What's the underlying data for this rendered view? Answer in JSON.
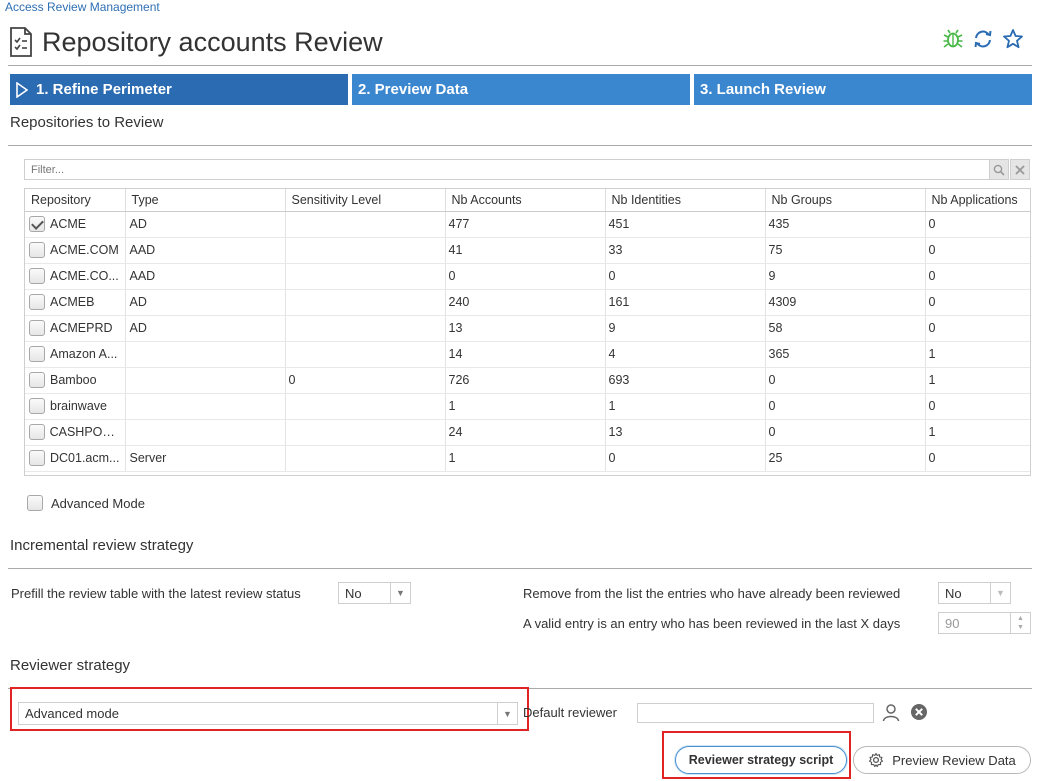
{
  "breadcrumb": "Access Review Management",
  "page_title": "Repository accounts Review",
  "steps": [
    {
      "label": "1. Refine Perimeter"
    },
    {
      "label": "2. Preview Data"
    },
    {
      "label": "3. Launch Review"
    }
  ],
  "repositories": {
    "title": "Repositories to Review",
    "filter_placeholder": "Filter...",
    "columns": [
      "Repository",
      "Type",
      "Sensitivity Level",
      "Nb Accounts",
      "Nb Identities",
      "Nb Groups",
      "Nb Applications"
    ],
    "rows": [
      {
        "checked": true,
        "repository": "ACME",
        "type": "AD",
        "sensitivity": "",
        "accounts": "477",
        "identities": "451",
        "groups": "435",
        "applications": "0"
      },
      {
        "checked": false,
        "repository": "ACME.COM",
        "type": "AAD",
        "sensitivity": "",
        "accounts": "41",
        "identities": "33",
        "groups": "75",
        "applications": "0"
      },
      {
        "checked": false,
        "repository": "ACME.CO...",
        "type": "AAD",
        "sensitivity": "",
        "accounts": "0",
        "identities": "0",
        "groups": "9",
        "applications": "0"
      },
      {
        "checked": false,
        "repository": "ACMEB",
        "type": "AD",
        "sensitivity": "",
        "accounts": "240",
        "identities": "161",
        "groups": "4309",
        "applications": "0"
      },
      {
        "checked": false,
        "repository": "ACMEPRD",
        "type": "AD",
        "sensitivity": "",
        "accounts": "13",
        "identities": "9",
        "groups": "58",
        "applications": "0"
      },
      {
        "checked": false,
        "repository": "Amazon A...",
        "type": "",
        "sensitivity": "",
        "accounts": "14",
        "identities": "4",
        "groups": "365",
        "applications": "1"
      },
      {
        "checked": false,
        "repository": "Bamboo",
        "type": "",
        "sensitivity": "0",
        "accounts": "726",
        "identities": "693",
        "groups": "0",
        "applications": "1"
      },
      {
        "checked": false,
        "repository": "brainwave",
        "type": "",
        "sensitivity": "",
        "accounts": "1",
        "identities": "1",
        "groups": "0",
        "applications": "0"
      },
      {
        "checked": false,
        "repository": "CASHPOO...",
        "type": "",
        "sensitivity": "",
        "accounts": "24",
        "identities": "13",
        "groups": "0",
        "applications": "1"
      },
      {
        "checked": false,
        "repository": "DC01.acm...",
        "type": "Server",
        "sensitivity": "",
        "accounts": "1",
        "identities": "0",
        "groups": "25",
        "applications": "0"
      }
    ],
    "advanced_mode_label": "Advanced Mode"
  },
  "incremental": {
    "title": "Incremental review strategy",
    "prefill_label": "Prefill the review table with the latest review status",
    "prefill_value": "No",
    "remove_label": "Remove from the list the entries who have already been reviewed",
    "remove_value": "No",
    "valid_label": "A valid entry is an entry who has been reviewed in the last X days",
    "valid_value": "90"
  },
  "reviewer": {
    "title": "Reviewer strategy",
    "strategy_value": "Advanced mode",
    "default_reviewer_label": "Default reviewer",
    "default_reviewer_value": ""
  },
  "buttons": {
    "script": "Reviewer strategy script",
    "preview": "Preview Review Data"
  },
  "colors": {
    "step_active": "#2a6bb2",
    "step": "#3a86cf",
    "highlight": "#e02424",
    "link": "#2f6fb4"
  }
}
